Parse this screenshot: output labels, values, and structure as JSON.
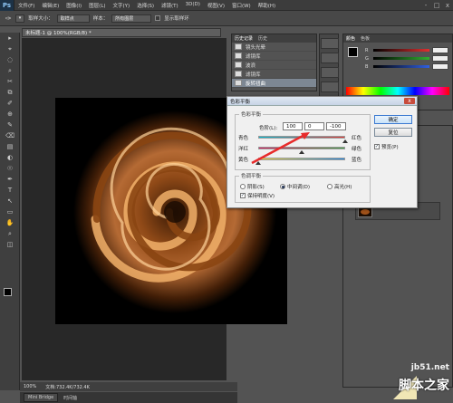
{
  "app": {
    "logo": "Ps"
  },
  "menu": [
    "文件(F)",
    "编辑(E)",
    "图像(I)",
    "图层(L)",
    "文字(Y)",
    "选择(S)",
    "滤镜(T)",
    "3D(D)",
    "视图(V)",
    "窗口(W)",
    "帮助(H)"
  ],
  "window_buttons": [
    "-",
    "□",
    "x"
  ],
  "options_bar": {
    "sample_size_label": "取样大小：",
    "sample_size_value": "取样点",
    "sample_label": "样本：",
    "sample_value": "所有图层",
    "show_ring_label": "显示取样环"
  },
  "document_tab": "未标题-1 @ 100%(RGB/8) *",
  "tools": [
    "▸",
    "⌖",
    "◌",
    "⌕",
    "✂",
    "⧉",
    "✐",
    "⊕",
    "✎",
    "⌫",
    "▤",
    "◐",
    "☉",
    "✒",
    "T",
    "↖",
    "▭",
    "✋",
    "⌕",
    "◫"
  ],
  "history_panel": {
    "tabs": [
      "历史记录",
      "历史"
    ],
    "items": [
      {
        "label": "镜头光晕",
        "selected": false
      },
      {
        "label": "滤镜库",
        "selected": false
      },
      {
        "label": "波浪",
        "selected": false
      },
      {
        "label": "滤镜库",
        "selected": false
      },
      {
        "label": "旋转扭曲",
        "selected": true
      }
    ]
  },
  "color_panel": {
    "tabs": [
      "颜色",
      "色板"
    ],
    "channels": [
      {
        "label": "R",
        "color": "#e03030"
      },
      {
        "label": "G",
        "color": "#30b030"
      },
      {
        "label": "B",
        "color": "#3060e0"
      }
    ]
  },
  "status_bar": {
    "zoom": "100%",
    "doc": "文档:732.4K/732.4K"
  },
  "bottom_tabs": [
    "Mini Bridge",
    "时间轴"
  ],
  "dialog": {
    "title": "色彩平衡",
    "close": "x",
    "balance_group": "色彩平衡",
    "levels_label": "色阶(L):",
    "levels": [
      "100",
      "0",
      "-100"
    ],
    "sliders": [
      {
        "left": "青色",
        "right": "红色",
        "value": 100
      },
      {
        "left": "洋红",
        "right": "绿色",
        "value": 0
      },
      {
        "left": "黄色",
        "right": "蓝色",
        "value": -100
      }
    ],
    "tone_group": "色调平衡",
    "tones": [
      {
        "label": "阴影(S)",
        "checked": false
      },
      {
        "label": "中间调(D)",
        "checked": true
      },
      {
        "label": "高光(H)",
        "checked": false
      }
    ],
    "preserve_label": "保持明度(V)",
    "preserve_checked": true,
    "ok_label": "确定",
    "reset_label": "复位",
    "preview_label": "预览(P)",
    "preview_checked": true
  },
  "watermark": {
    "url": "jb51.net",
    "name": "脚本之家"
  }
}
